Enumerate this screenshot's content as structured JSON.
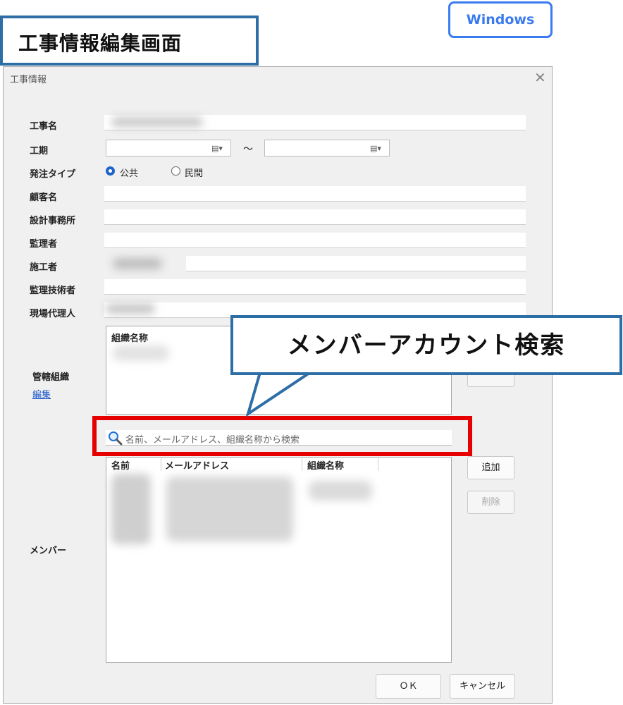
{
  "banner": {
    "title": "工事情報編集画面",
    "os_badge": "Windows"
  },
  "dialog": {
    "title": "工事情報",
    "close_glyph": "✕",
    "fields": {
      "name_label": "工事名",
      "period_label": "工期",
      "period_separator": "～",
      "order_type_label": "発注タイプ",
      "order_type_options": [
        "公共",
        "民間"
      ],
      "order_type_selected": "公共",
      "customer_label": "顧客名",
      "design_office_label": "設計事務所",
      "supervisor_label": "監理者",
      "contractor_label": "施工者",
      "supervising_engineer_label": "監理技術者",
      "site_agent_label": "現場代理人"
    },
    "org_section": {
      "label": "管轄組織",
      "edit_link": "編集",
      "column_header": "組織名称"
    },
    "member_section": {
      "label": "メンバー",
      "search_placeholder": "名前、メールアドレス、組織名称から検索",
      "columns": [
        "名前",
        "メールアドレス",
        "組織名称"
      ],
      "add_button": "追加",
      "delete_button": "削除"
    },
    "footer": {
      "ok": "ＯＫ",
      "cancel": "キャンセル"
    }
  },
  "callout": {
    "text": "メンバーアカウント検索"
  },
  "colors": {
    "banner_border": "#2e6ea6",
    "badge": "#3a7bf0",
    "highlight": "#e60000",
    "link": "#1a56c8"
  },
  "icons": {
    "search": "search-icon",
    "calendar": "calendar-icon",
    "close": "close-icon"
  }
}
